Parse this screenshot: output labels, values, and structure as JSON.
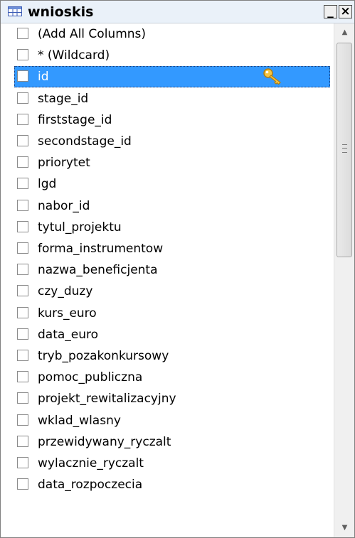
{
  "window": {
    "title": "wnioskis",
    "minimize_label": "_",
    "close_label": "×",
    "title_icon": "table-icon"
  },
  "columns": [
    {
      "label": "(Add All Columns)"
    },
    {
      "label": "* (Wildcard)"
    },
    {
      "label": "id",
      "selected": true,
      "primary_key": true,
      "key_icon": "key-icon"
    },
    {
      "label": "stage_id"
    },
    {
      "label": "firststage_id"
    },
    {
      "label": "secondstage_id"
    },
    {
      "label": "priorytet"
    },
    {
      "label": "lgd"
    },
    {
      "label": "nabor_id"
    },
    {
      "label": "tytul_projektu"
    },
    {
      "label": "forma_instrumentow"
    },
    {
      "label": "nazwa_beneficjenta"
    },
    {
      "label": "czy_duzy"
    },
    {
      "label": "kurs_euro"
    },
    {
      "label": "data_euro"
    },
    {
      "label": "tryb_pozakonkursowy"
    },
    {
      "label": "pomoc_publiczna"
    },
    {
      "label": "projekt_rewitalizacyjny"
    },
    {
      "label": "wklad_wlasny"
    },
    {
      "label": "przewidywany_ryczalt"
    },
    {
      "label": "wylacznie_ryczalt"
    },
    {
      "label": "data_rozpoczecia"
    }
  ],
  "scrollbar": {
    "up_arrow": "▲",
    "down_arrow": "▼"
  },
  "colors": {
    "selection": "#3399ff",
    "titlebar": "#eaf1f9"
  }
}
